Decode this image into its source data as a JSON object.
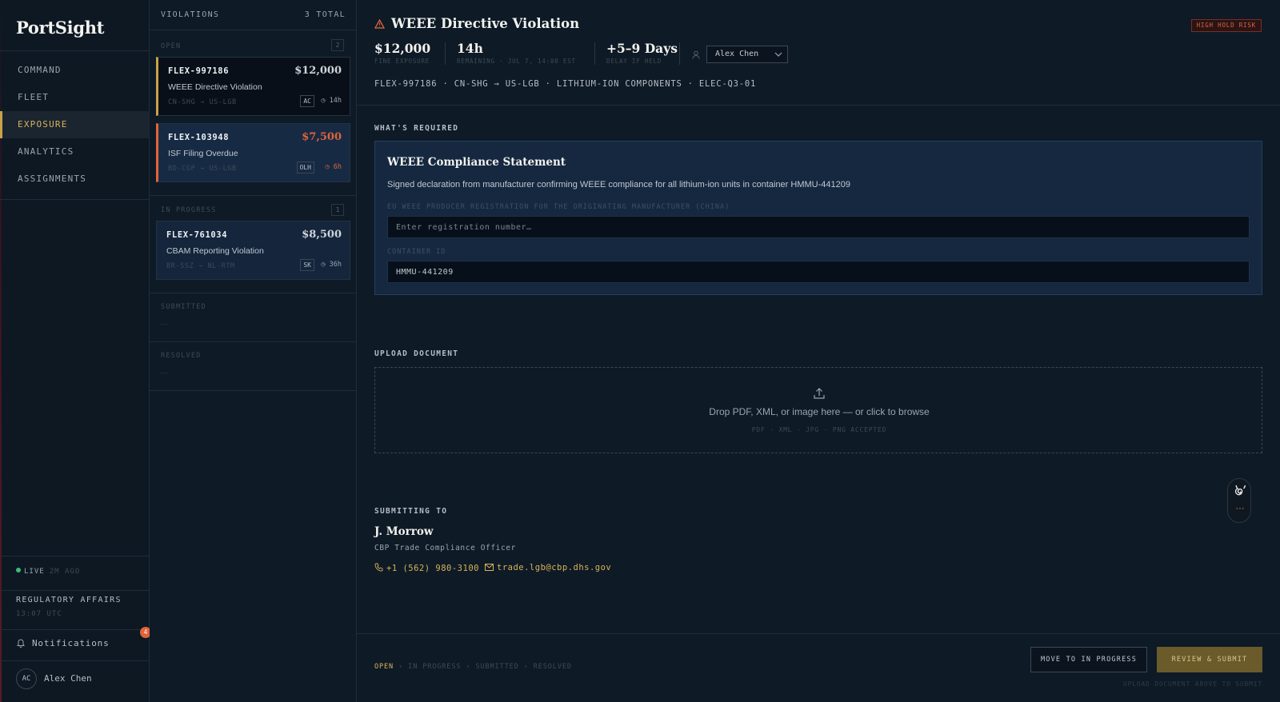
{
  "brand": "PortSight",
  "nav": [
    {
      "label": "COMMAND"
    },
    {
      "label": "FLEET"
    },
    {
      "label": "EXPOSURE"
    },
    {
      "label": "ANALYTICS"
    },
    {
      "label": "ASSIGNMENTS"
    }
  ],
  "status": {
    "live": "LIVE",
    "ago": "2M AGO"
  },
  "org": {
    "name": "REGULATORY AFFAIRS",
    "time": "13:07 UTC"
  },
  "notifications": {
    "label": "Notifications",
    "count": "4"
  },
  "user": {
    "initials": "AC",
    "name": "Alex Chen"
  },
  "list": {
    "title": "VIOLATIONS",
    "total": "3 TOTAL",
    "groups": [
      {
        "label": "OPEN",
        "count": "2"
      },
      {
        "label": "IN PROGRESS",
        "count": "1"
      },
      {
        "label": "SUBMITTED",
        "empty": "—"
      },
      {
        "label": "RESOLVED",
        "empty": "—"
      }
    ],
    "cards": [
      {
        "id": "FLEX-997186",
        "amount": "$12,000",
        "title": "WEEE Directive Violation",
        "route": "CN-SHG → US-LGB",
        "tag": "AC",
        "due": "14h"
      },
      {
        "id": "FLEX-103948",
        "amount": "$7,500",
        "title": "ISF Filing Overdue",
        "route": "BD-CGP → US-LGB",
        "tag": "OLH",
        "due": "6h"
      },
      {
        "id": "FLEX-761034",
        "amount": "$8,500",
        "title": "CBAM Reporting Violation",
        "route": "BR-SSZ → NL-RTM",
        "tag": "SK",
        "due": "36h"
      }
    ]
  },
  "detail": {
    "title": "WEEE Directive Violation",
    "risk": "HIGH HOLD RISK",
    "metrics": [
      {
        "value": "$12,000",
        "label": "FINE EXPOSURE"
      },
      {
        "value": "14h",
        "label": "REMAINING · JUL 7, 14:00 EST"
      },
      {
        "value": "+5–9 Days",
        "label": "DELAY IF HELD"
      }
    ],
    "owner": "Alex Chen",
    "meta": "FLEX-997186 · CN-SHG → US-LGB · LITHIUM-ION COMPONENTS · ELEC-Q3-01",
    "required_label": "WHAT'S REQUIRED",
    "requirement": {
      "title": "WEEE Compliance Statement",
      "description": "Signed declaration from manufacturer confirming WEEE compliance for all lithium-ion units in container HMMU-441209",
      "field1_label": "EU WEEE PRODUCER REGISTRATION FOR THE ORIGINATING MANUFACTURER (CHINA)",
      "field1_placeholder": "Enter registration number…",
      "field2_label": "CONTAINER ID",
      "field2_value": "HMMU-441209"
    },
    "upload_label": "UPLOAD DOCUMENT",
    "upload_main": "Drop PDF, XML, or image here — or click to browse",
    "upload_sub": "PDF · XML · JPG · PNG ACCEPTED",
    "submit_label": "SUBMITTING TO",
    "contact": {
      "name": "J. Morrow",
      "role": "CBP Trade Compliance Officer",
      "phone": "+1 (562) 980-3100",
      "email": "trade.lgb@cbp.dhs.gov"
    },
    "steps": [
      "OPEN",
      "IN PROGRESS",
      "SUBMITTED",
      "RESOLVED"
    ],
    "step_sep": "›",
    "btn_progress": "MOVE TO IN PROGRESS",
    "btn_submit": "REVIEW & SUBMIT",
    "btn_hint": "UPLOAD DOCUMENT ABOVE TO SUBMIT"
  },
  "colors": {
    "accent": "#c9a24a",
    "danger": "#e0643a",
    "background": "#0e1a26"
  }
}
